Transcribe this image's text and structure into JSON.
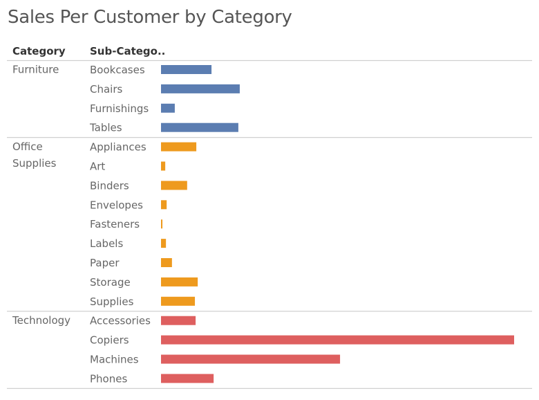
{
  "chart_data": {
    "type": "bar",
    "orientation": "horizontal",
    "title": "Sales Per Customer by Category",
    "xlabel": "",
    "ylabel": "",
    "column_headers": [
      "Category",
      "Sub-Catego.."
    ],
    "axis_shown": false,
    "value_units": "relative (Copiers = 100)",
    "xlim": [
      0,
      100
    ],
    "grid": false,
    "legend": "none",
    "groups": [
      {
        "category": "Furniture",
        "category_lines": [
          "Furniture"
        ],
        "color": "#5b7db1",
        "items": [
          {
            "sub": "Bookcases",
            "value": 14.3
          },
          {
            "sub": "Chairs",
            "value": 22.3
          },
          {
            "sub": "Furnishings",
            "value": 3.9
          },
          {
            "sub": "Tables",
            "value": 21.9
          }
        ]
      },
      {
        "category": "Office Supplies",
        "category_lines": [
          "Office",
          "Supplies"
        ],
        "color": "#ee9a1e",
        "items": [
          {
            "sub": "Appliances",
            "value": 10.0
          },
          {
            "sub": "Art",
            "value": 1.2
          },
          {
            "sub": "Binders",
            "value": 7.4
          },
          {
            "sub": "Envelopes",
            "value": 1.6
          },
          {
            "sub": "Fasteners",
            "value": 0.4
          },
          {
            "sub": "Labels",
            "value": 1.4
          },
          {
            "sub": "Paper",
            "value": 3.1
          },
          {
            "sub": "Storage",
            "value": 10.4
          },
          {
            "sub": "Supplies",
            "value": 9.6
          }
        ]
      },
      {
        "category": "Technology",
        "category_lines": [
          "Technology"
        ],
        "color": "#de5f5f",
        "items": [
          {
            "sub": "Accessories",
            "value": 9.8
          },
          {
            "sub": "Copiers",
            "value": 100
          },
          {
            "sub": "Machines",
            "value": 50.7
          },
          {
            "sub": "Phones",
            "value": 14.9
          }
        ]
      }
    ]
  }
}
